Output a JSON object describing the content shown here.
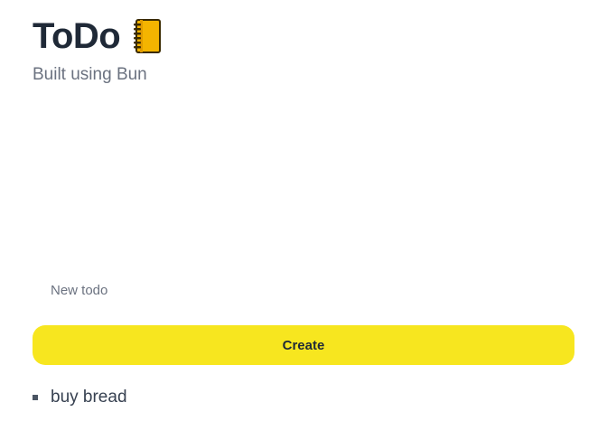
{
  "header": {
    "title": "ToDo",
    "title_icon": "notebook-icon",
    "subtitle": "Built using Bun"
  },
  "form": {
    "input_placeholder": "New todo",
    "input_value": "",
    "create_label": "Create"
  },
  "todos": [
    {
      "text": "buy bread"
    }
  ],
  "colors": {
    "accent": "#f7e61f",
    "title": "#1f2937",
    "muted": "#6b7280"
  }
}
